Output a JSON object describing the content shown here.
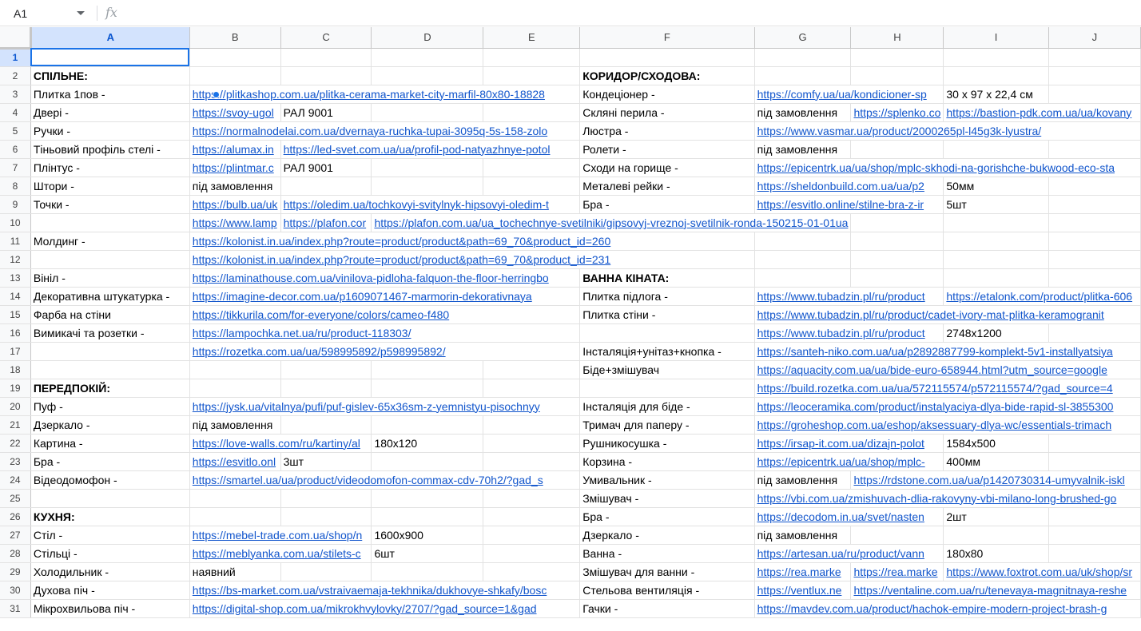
{
  "namebox": "A1",
  "fx": "fx",
  "columns": [
    "A",
    "B",
    "C",
    "D",
    "E",
    "F",
    "G",
    "H",
    "I",
    "J"
  ],
  "col_widths": [
    216,
    114,
    114,
    132,
    114,
    206,
    114,
    114,
    132,
    120
  ],
  "rows": [
    {
      "n": "1",
      "cells": [
        {
          "v": "",
          "t": "active"
        },
        {
          "v": ""
        },
        {
          "v": ""
        },
        {
          "v": ""
        },
        {
          "v": ""
        },
        {
          "v": ""
        },
        {
          "v": ""
        },
        {
          "v": ""
        },
        {
          "v": ""
        },
        {
          "v": ""
        }
      ]
    },
    {
      "n": "2",
      "cells": [
        {
          "v": "СПІЛЬНЕ:",
          "t": "bold"
        },
        {
          "v": ""
        },
        {
          "v": ""
        },
        {
          "v": ""
        },
        {
          "v": ""
        },
        {
          "v": "КОРИДОР/СХОДОВА:",
          "t": "bold"
        },
        {
          "v": ""
        },
        {
          "v": ""
        },
        {
          "v": ""
        },
        {
          "v": ""
        }
      ]
    },
    {
      "n": "3",
      "cells": [
        {
          "v": "Плитка 1пов -"
        },
        {
          "v": "https://plitkashop.com.ua/plitka-cerama-market-city-marfil-80x80-18828",
          "t": "link",
          "span": 4
        },
        {
          "v": "Кондеціонер -"
        },
        {
          "v": "https://comfy.ua/ua/kondicioner-sp",
          "t": "link",
          "span": 2
        },
        {
          "v": "30 x 97 x 22,4 см"
        },
        {
          "v": ""
        }
      ]
    },
    {
      "n": "4",
      "cells": [
        {
          "v": "Двері -"
        },
        {
          "v": "https://svoy-ugol",
          "t": "link"
        },
        {
          "v": "РАЛ 9001"
        },
        {
          "v": ""
        },
        {
          "v": ""
        },
        {
          "v": "Скляні перила -"
        },
        {
          "v": "під замовлення"
        },
        {
          "v": "https://splenko.co",
          "t": "link"
        },
        {
          "v": "https://bastion-pdk.com.ua/ua/kovany",
          "t": "link",
          "span": 2
        }
      ]
    },
    {
      "n": "5",
      "cells": [
        {
          "v": "Ручки -"
        },
        {
          "v": "https://normalnodelai.com.ua/dvernaya-ruchka-tupai-3095q-5s-158-zolo",
          "t": "link",
          "span": 4
        },
        {
          "v": "Люстра -"
        },
        {
          "v": "https://www.vasmar.ua/product/2000265pl-l45g3k-lyustra/",
          "t": "link",
          "span": 4
        }
      ]
    },
    {
      "n": "6",
      "cells": [
        {
          "v": "Тіньовий профіль стелі -"
        },
        {
          "v": "https://alumax.in",
          "t": "link"
        },
        {
          "v": "https://led-svet.com.ua/ua/profil-pod-natyazhnye-potol",
          "t": "link",
          "span": 3
        },
        {
          "v": "Ролети -"
        },
        {
          "v": "під замовлення"
        },
        {
          "v": ""
        },
        {
          "v": ""
        },
        {
          "v": ""
        }
      ]
    },
    {
      "n": "7",
      "cells": [
        {
          "v": "Плінтус -"
        },
        {
          "v": "https://plintmar.c",
          "t": "link"
        },
        {
          "v": "РАЛ 9001"
        },
        {
          "v": ""
        },
        {
          "v": ""
        },
        {
          "v": "Сходи на горище -"
        },
        {
          "v": "https://epicentrk.ua/ua/shop/mplc-skhodi-na-gorishche-bukwood-eco-sta",
          "t": "link",
          "span": 4
        }
      ]
    },
    {
      "n": "8",
      "cells": [
        {
          "v": "Штори -"
        },
        {
          "v": "під замовлення"
        },
        {
          "v": ""
        },
        {
          "v": ""
        },
        {
          "v": ""
        },
        {
          "v": "Металеві рейки -"
        },
        {
          "v": "https://sheldonbuild.com.ua/ua/p2",
          "t": "link",
          "span": 2
        },
        {
          "v": "50мм"
        },
        {
          "v": ""
        }
      ]
    },
    {
      "n": "9",
      "cells": [
        {
          "v": "Точки -"
        },
        {
          "v": "https://bulb.ua/uk",
          "t": "link"
        },
        {
          "v": "https://oledim.ua/tochkovyi-svitylnyk-hipsovyi-oledim-t",
          "t": "link",
          "span": 3
        },
        {
          "v": "Бра -"
        },
        {
          "v": "https://esvitlo.online/stilne-bra-z-ir",
          "t": "link",
          "span": 2
        },
        {
          "v": "5шт"
        },
        {
          "v": ""
        }
      ]
    },
    {
      "n": "10",
      "cells": [
        {
          "v": ""
        },
        {
          "v": "https://www.lamp",
          "t": "link"
        },
        {
          "v": "https://plafon.cor",
          "t": "link"
        },
        {
          "v": "https://plafon.com.ua/ua_tochechnye-svetilniki/gipsovyj-vreznoj-svetilnik-ronda-150215-01-01ua",
          "t": "link",
          "span": 4
        },
        {
          "v": ""
        },
        {
          "v": ""
        },
        {
          "v": ""
        }
      ]
    },
    {
      "n": "11",
      "cells": [
        {
          "v": "Молдинг -"
        },
        {
          "v": "https://kolonist.in.ua/index.php?route=product/product&path=69_70&product_id=260",
          "t": "link",
          "span": 5
        },
        {
          "v": ""
        },
        {
          "v": ""
        },
        {
          "v": ""
        },
        {
          "v": ""
        }
      ]
    },
    {
      "n": "12",
      "cells": [
        {
          "v": ""
        },
        {
          "v": "https://kolonist.in.ua/index.php?route=product/product&path=69_70&product_id=231",
          "t": "link",
          "span": 5
        },
        {
          "v": ""
        },
        {
          "v": ""
        },
        {
          "v": ""
        },
        {
          "v": ""
        }
      ]
    },
    {
      "n": "13",
      "cells": [
        {
          "v": "Вініл -"
        },
        {
          "v": "https://laminathouse.com.ua/vinilova-pidloha-falquon-the-floor-herringbo",
          "t": "link",
          "span": 4
        },
        {
          "v": "ВАННА КІНАТА:",
          "t": "bold"
        },
        {
          "v": ""
        },
        {
          "v": ""
        },
        {
          "v": ""
        },
        {
          "v": ""
        }
      ]
    },
    {
      "n": "14",
      "cells": [
        {
          "v": "Декоративна штукатурка -"
        },
        {
          "v": "https://imagine-decor.com.ua/p1609071467-marmorin-dekorativnaya",
          "t": "link",
          "span": 4
        },
        {
          "v": "Плитка підлога -"
        },
        {
          "v": "https://www.tubadzin.pl/ru/product",
          "t": "link",
          "span": 2
        },
        {
          "v": "https://etalonk.com/product/plitka-606",
          "t": "link",
          "span": 2
        }
      ]
    },
    {
      "n": "15",
      "cells": [
        {
          "v": "Фарба на стіни"
        },
        {
          "v": "https://tikkurila.com/for-everyone/colors/cameo-f480",
          "t": "link",
          "span": 4
        },
        {
          "v": "Плитка стіни -"
        },
        {
          "v": "https://www.tubadzin.pl/ru/product/cadet-ivory-mat-plitka-keramogranit",
          "t": "link",
          "span": 4
        }
      ]
    },
    {
      "n": "16",
      "cells": [
        {
          "v": "Вимикачі та розетки -"
        },
        {
          "v": "https://lampochka.net.ua/ru/product-118303/",
          "t": "link",
          "span": 4
        },
        {
          "v": ""
        },
        {
          "v": "https://www.tubadzin.pl/ru/product",
          "t": "link",
          "span": 2
        },
        {
          "v": "2748x1200"
        },
        {
          "v": ""
        }
      ]
    },
    {
      "n": "17",
      "cells": [
        {
          "v": ""
        },
        {
          "v": "https://rozetka.com.ua/ua/598995892/p598995892/",
          "t": "link",
          "span": 4
        },
        {
          "v": "Інсталяція+унітаз+кнопка -"
        },
        {
          "v": "https://santeh-niko.com.ua/ua/p2892887799-komplekt-5v1-installyatsiya",
          "t": "link",
          "span": 4
        }
      ]
    },
    {
      "n": "18",
      "cells": [
        {
          "v": ""
        },
        {
          "v": ""
        },
        {
          "v": ""
        },
        {
          "v": ""
        },
        {
          "v": ""
        },
        {
          "v": "Біде+змішувач"
        },
        {
          "v": "https://aquacity.com.ua/ua/bide-euro-658944.html?utm_source=google",
          "t": "link",
          "span": 4
        }
      ]
    },
    {
      "n": "19",
      "cells": [
        {
          "v": "ПЕРЕДПОКІЙ:",
          "t": "bold"
        },
        {
          "v": ""
        },
        {
          "v": ""
        },
        {
          "v": ""
        },
        {
          "v": ""
        },
        {
          "v": ""
        },
        {
          "v": "https://build.rozetka.com.ua/ua/572115574/p572115574/?gad_source=4",
          "t": "link",
          "span": 4
        }
      ]
    },
    {
      "n": "20",
      "cells": [
        {
          "v": "Пуф -"
        },
        {
          "v": "https://jysk.ua/vitalnya/pufi/puf-gislev-65x36sm-z-yemnistyu-pisochnyy",
          "t": "link",
          "span": 4
        },
        {
          "v": "Інсталяція для біде -"
        },
        {
          "v": "https://leoceramika.com/product/instalyaciya-dlya-bide-rapid-sl-3855300",
          "t": "link",
          "span": 4
        }
      ]
    },
    {
      "n": "21",
      "cells": [
        {
          "v": "Дзеркало -"
        },
        {
          "v": "під замовлення"
        },
        {
          "v": ""
        },
        {
          "v": ""
        },
        {
          "v": ""
        },
        {
          "v": "Тримач для паперу -"
        },
        {
          "v": "https://groheshop.com.ua/eshop/aksessuary-dlya-wc/essentials-trimach",
          "t": "link",
          "span": 4
        }
      ]
    },
    {
      "n": "22",
      "cells": [
        {
          "v": "Картина -"
        },
        {
          "v": "https://love-walls.com/ru/kartiny/al",
          "t": "link",
          "span": 2
        },
        {
          "v": "180x120"
        },
        {
          "v": ""
        },
        {
          "v": "Рушникосушка -"
        },
        {
          "v": "https://irsap-it.com.ua/dizajn-polot",
          "t": "link",
          "span": 2
        },
        {
          "v": "1584x500"
        },
        {
          "v": ""
        }
      ]
    },
    {
      "n": "23",
      "cells": [
        {
          "v": "Бра -"
        },
        {
          "v": "https://esvitlo.onl",
          "t": "link"
        },
        {
          "v": "3шт"
        },
        {
          "v": ""
        },
        {
          "v": ""
        },
        {
          "v": "Корзина -"
        },
        {
          "v": "https://epicentrk.ua/ua/shop/mplc-",
          "t": "link",
          "span": 2
        },
        {
          "v": "400мм"
        },
        {
          "v": ""
        }
      ]
    },
    {
      "n": "24",
      "cells": [
        {
          "v": "Відеодомофон -"
        },
        {
          "v": "https://smartel.ua/ua/product/videodomofon-commax-cdv-70h2/?gad_s",
          "t": "link",
          "span": 4
        },
        {
          "v": "Умивальник -"
        },
        {
          "v": "під замовлення"
        },
        {
          "v": "https://rdstone.com.ua/ua/p1420730314-umyvalnik-iskl",
          "t": "link",
          "span": 3
        }
      ]
    },
    {
      "n": "25",
      "cells": [
        {
          "v": ""
        },
        {
          "v": ""
        },
        {
          "v": ""
        },
        {
          "v": ""
        },
        {
          "v": ""
        },
        {
          "v": "Змішувач -"
        },
        {
          "v": "https://vbi.com.ua/zmishuvach-dlia-rakovyny-vbi-milano-long-brushed-go",
          "t": "link",
          "span": 4
        }
      ]
    },
    {
      "n": "26",
      "cells": [
        {
          "v": "КУХНЯ:",
          "t": "bold"
        },
        {
          "v": ""
        },
        {
          "v": ""
        },
        {
          "v": ""
        },
        {
          "v": ""
        },
        {
          "v": "Бра -"
        },
        {
          "v": "https://decodom.in.ua/svet/nasten",
          "t": "link",
          "span": 2
        },
        {
          "v": "2шт"
        },
        {
          "v": ""
        }
      ]
    },
    {
      "n": "27",
      "cells": [
        {
          "v": "Стіл -"
        },
        {
          "v": "https://mebel-trade.com.ua/shop/n",
          "t": "link",
          "span": 2
        },
        {
          "v": "1600x900"
        },
        {
          "v": ""
        },
        {
          "v": "Дзеркало -"
        },
        {
          "v": "під замовлення"
        },
        {
          "v": ""
        },
        {
          "v": ""
        },
        {
          "v": ""
        }
      ]
    },
    {
      "n": "28",
      "cells": [
        {
          "v": "Стільці -"
        },
        {
          "v": "https://meblyanka.com.ua/stilets-c",
          "t": "link",
          "span": 2
        },
        {
          "v": "6шт"
        },
        {
          "v": ""
        },
        {
          "v": "Ванна -"
        },
        {
          "v": "https://artesan.ua/ru/product/vann",
          "t": "link",
          "span": 2
        },
        {
          "v": "180x80"
        },
        {
          "v": ""
        }
      ]
    },
    {
      "n": "29",
      "cells": [
        {
          "v": "Холодильник -"
        },
        {
          "v": "наявний"
        },
        {
          "v": ""
        },
        {
          "v": ""
        },
        {
          "v": ""
        },
        {
          "v": "Змішувач для ванни -"
        },
        {
          "v": "https://rea.marke",
          "t": "link"
        },
        {
          "v": "https://rea.marke",
          "t": "link"
        },
        {
          "v": "https://www.foxtrot.com.ua/uk/shop/sr",
          "t": "link",
          "span": 2
        }
      ]
    },
    {
      "n": "30",
      "cells": [
        {
          "v": "Духова піч -"
        },
        {
          "v": "https://bs-market.com.ua/vstraivaemaja-tekhnika/dukhovye-shkafy/bosc",
          "t": "link",
          "span": 4
        },
        {
          "v": "Стельова вентиляція -"
        },
        {
          "v": "https://ventlux.ne",
          "t": "link"
        },
        {
          "v": "https://ventaline.com.ua/ru/tenevaya-magnitnaya-reshe",
          "t": "link",
          "span": 3
        }
      ]
    },
    {
      "n": "31",
      "cells": [
        {
          "v": "Мікрохвильова піч -"
        },
        {
          "v": "https://digital-shop.com.ua/mikrokhvylovky/2707/?gad_source=1&gad",
          "t": "link",
          "span": 4
        },
        {
          "v": "Гачки -"
        },
        {
          "v": "https://mavdev.com.ua/product/hachok-empire-modern-project-brash-g",
          "t": "link",
          "span": 4
        }
      ]
    }
  ]
}
